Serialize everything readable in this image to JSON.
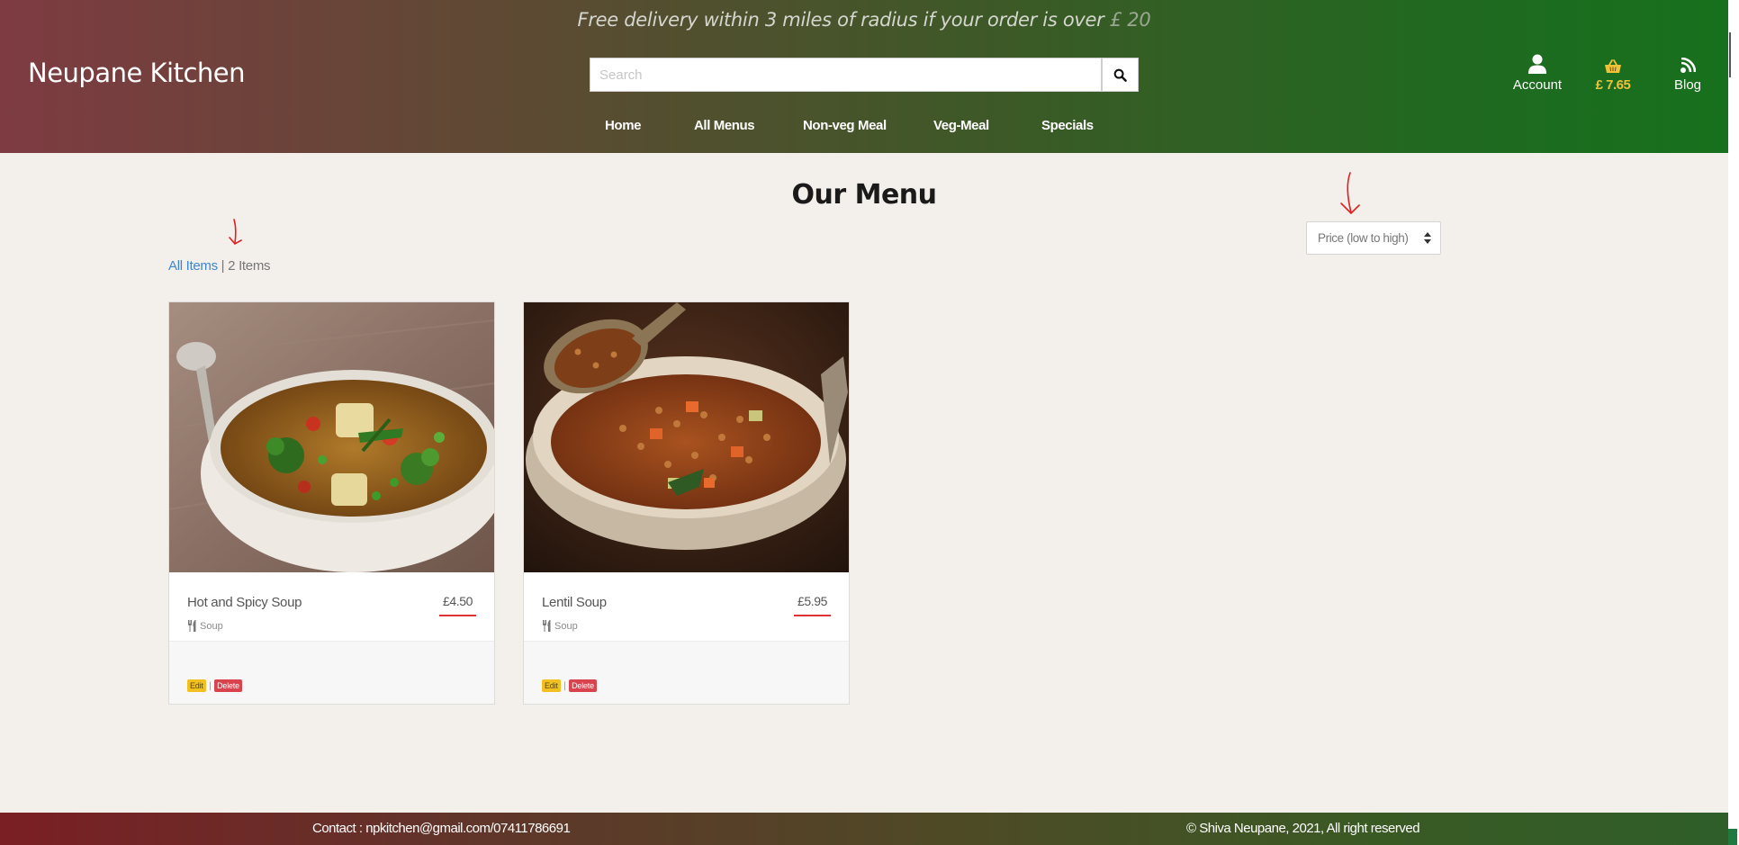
{
  "header": {
    "promo_text": "Free delivery within 3 miles of radius if your order is over",
    "promo_amount": "£ 20",
    "brand": "Neupane Kitchen",
    "search": {
      "placeholder": "Search"
    },
    "nav": [
      "Home",
      "All Menus",
      "Non-veg Meal",
      "Veg-Meal",
      "Specials"
    ],
    "account_label": "Account",
    "cart_total": "£ 7.65",
    "blog_label": "Blog"
  },
  "main": {
    "title": "Our Menu",
    "filter_link": "All Items",
    "filter_sep": " | ",
    "item_count": "2 Items",
    "sort": {
      "selected": "Price (low to high)"
    },
    "products": [
      {
        "name": "Hot and Spicy Soup",
        "price": "£4.50",
        "category": "Soup",
        "edit": "Edit",
        "delete": "Delete"
      },
      {
        "name": "Lentil Soup",
        "price": "£5.95",
        "category": "Soup",
        "edit": "Edit",
        "delete": "Delete"
      }
    ]
  },
  "footer": {
    "contact": "Contact : npkitchen@gmail.com/07411786691",
    "copyright": "© Shiva Neupane, 2021, All right reserved"
  },
  "colors": {
    "accent_yellow": "#f0c23a",
    "link_blue": "#3f86d0",
    "price_underline": "#dd3333",
    "annotation_red": "#e02020"
  },
  "icons": [
    "search-icon",
    "user-icon",
    "basket-icon",
    "blog-icon",
    "utensils-icon",
    "sort-caret-icon"
  ]
}
